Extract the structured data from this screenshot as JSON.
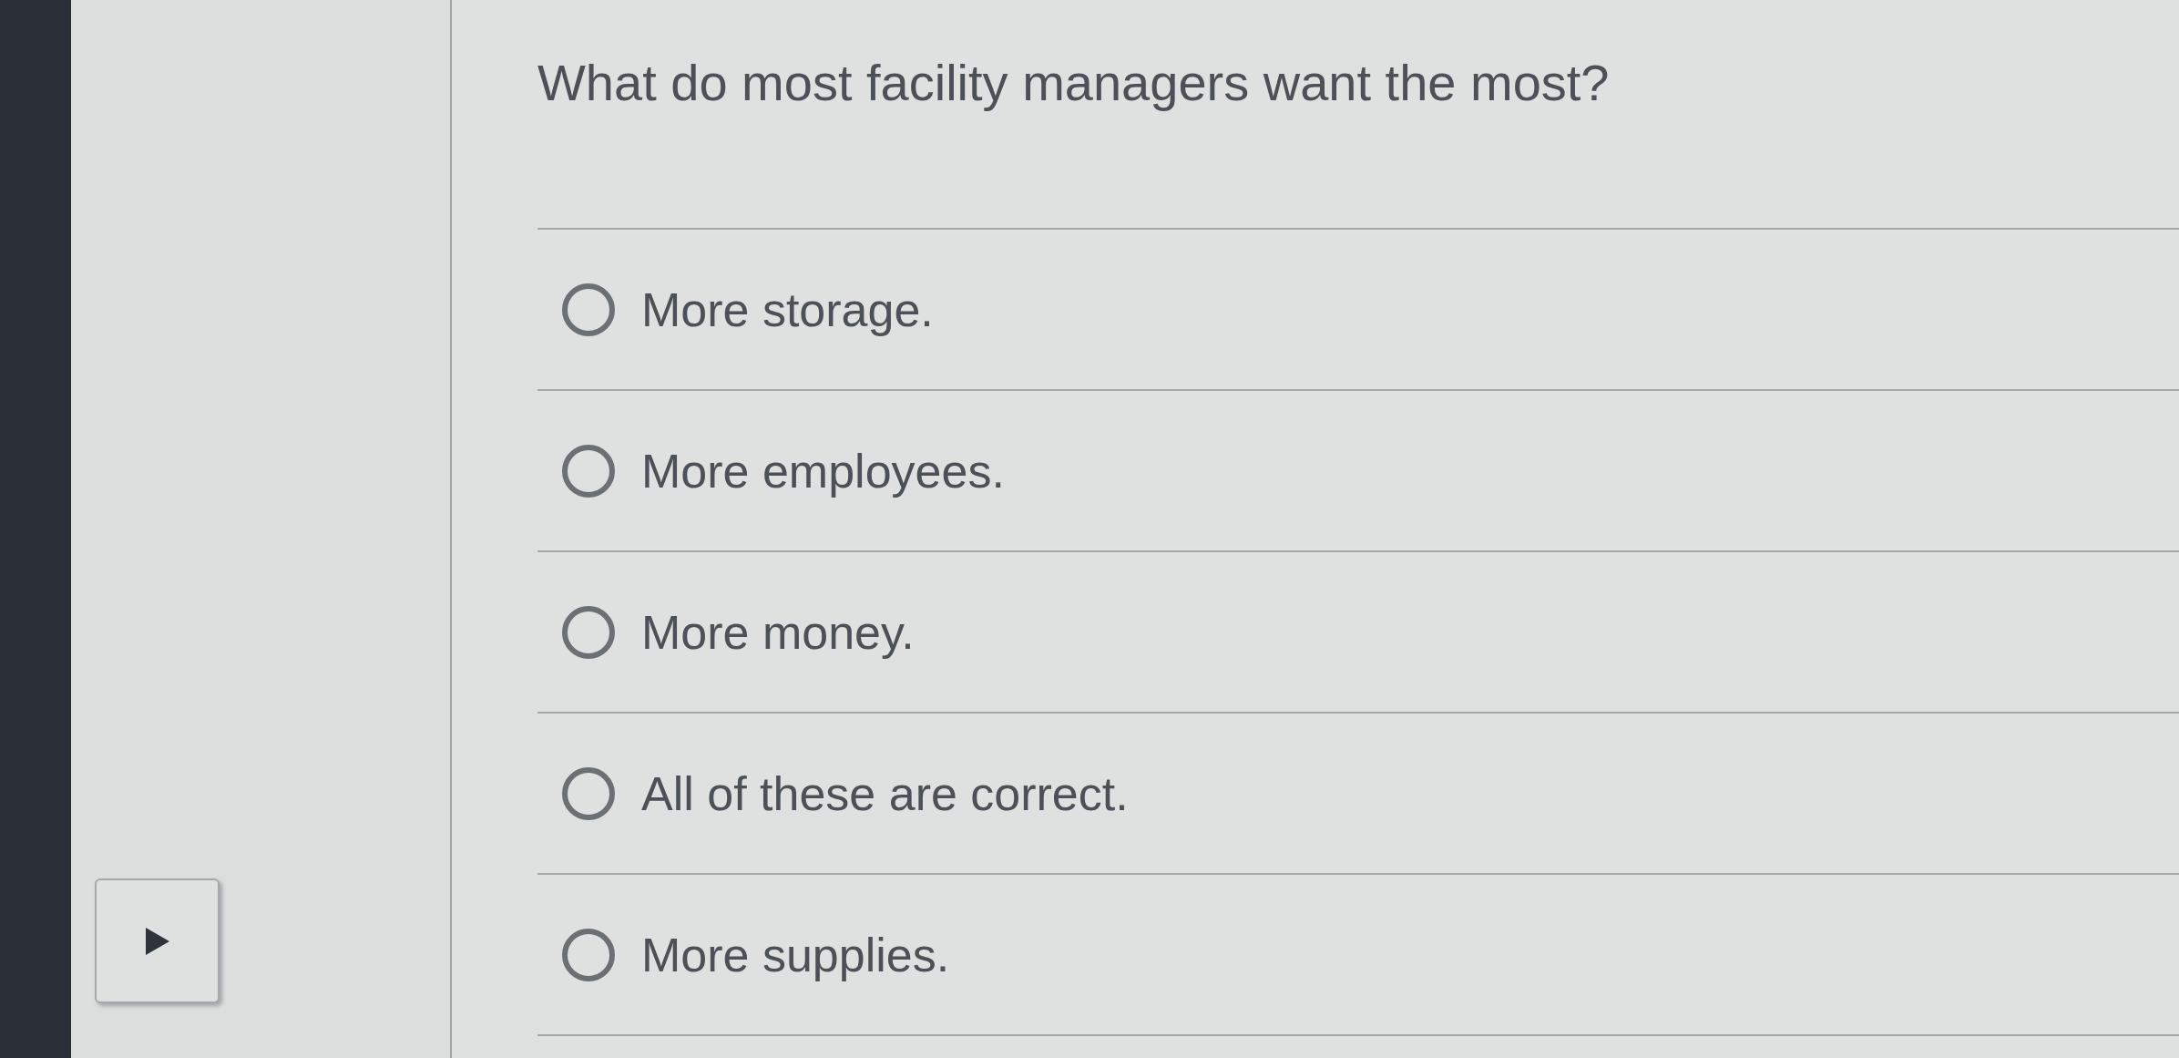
{
  "question": "What do most facility managers want the most?",
  "options": [
    {
      "label": "More storage.",
      "selected": false
    },
    {
      "label": "More employees.",
      "selected": false
    },
    {
      "label": "More money.",
      "selected": false
    },
    {
      "label": "All of these are correct.",
      "selected": false
    },
    {
      "label": "More supplies.",
      "selected": false
    }
  ]
}
